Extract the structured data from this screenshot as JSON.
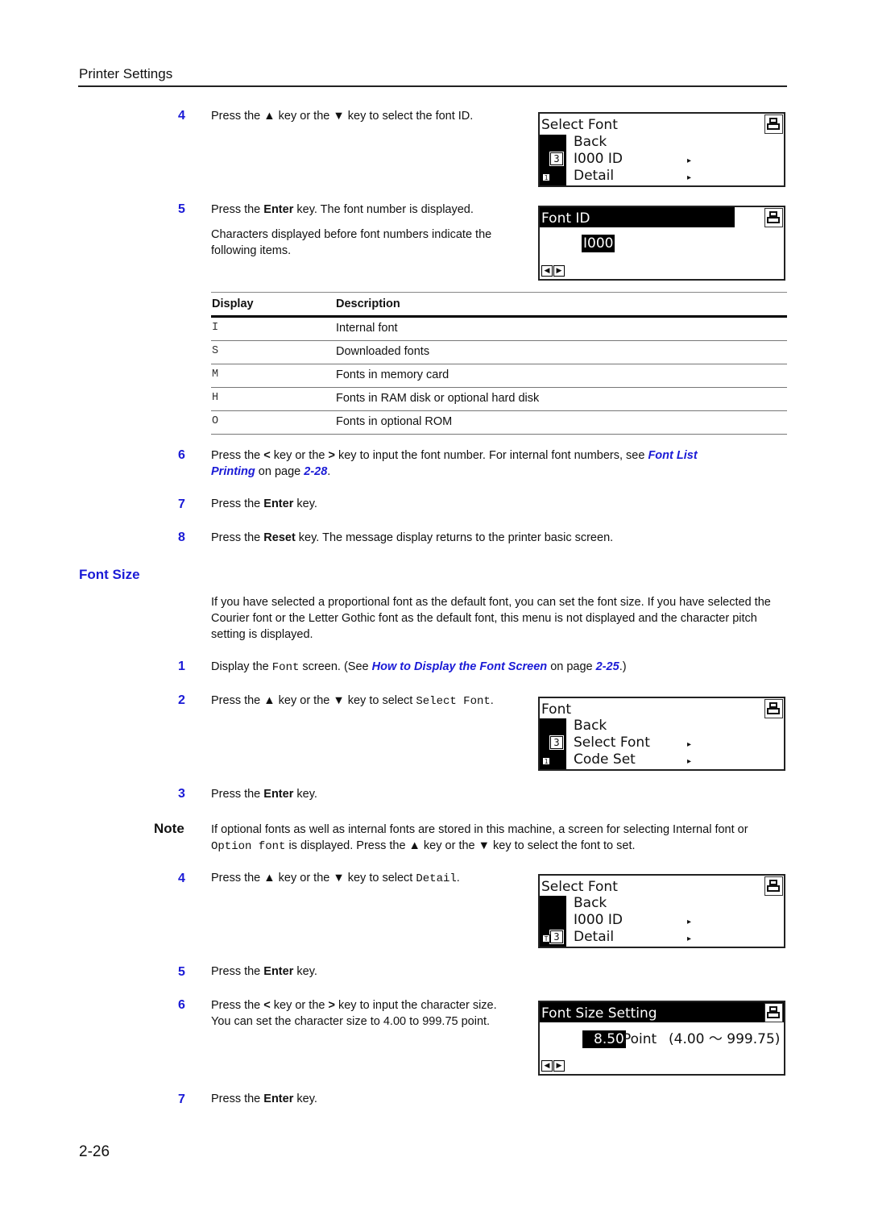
{
  "header": {
    "title": "Printer Settings"
  },
  "steps_top": [
    {
      "num": "4",
      "text_parts": [
        "Press the ",
        "▲",
        " key or the ",
        "▼",
        " key to select the font ID."
      ]
    },
    {
      "num": "5",
      "pre": "Press the ",
      "bold": "Enter",
      "post": " key. The font number is displayed.",
      "sub": "Characters displayed before font numbers indicate the following items."
    }
  ],
  "lcd_select_font_1": {
    "title": "Select Font",
    "items": [
      "Back",
      "I000  ID",
      "Detail"
    ],
    "page_box": "3",
    "small_box": "1",
    "arrow": "▸"
  },
  "lcd_font_id": {
    "title": "Font ID",
    "value": "I000",
    "left_key": "◀",
    "right_key": "▶"
  },
  "table": {
    "headers": [
      "Display",
      "Description"
    ],
    "rows": [
      [
        "I",
        "Internal font"
      ],
      [
        "S",
        "Downloaded fonts"
      ],
      [
        "M",
        "Fonts in memory card"
      ],
      [
        "H",
        "Fonts in RAM disk or optional hard disk"
      ],
      [
        "O",
        "Fonts in optional ROM"
      ]
    ]
  },
  "steps_mid": [
    {
      "num": "6",
      "pre": "Press the ",
      "k1": "<",
      "mid": " key or the ",
      "k2": ">",
      "post": " key to input the font number. For internal font numbers, see ",
      "link": "Font List Printing",
      "link_a": "Font List",
      "link_b": "Printing",
      "on_page": " on page ",
      "page": "2-28",
      "end": "."
    },
    {
      "num": "7",
      "pre": "Press the ",
      "bold": "Enter",
      "post": " key."
    },
    {
      "num": "8",
      "pre": "Press the ",
      "bold": "Reset",
      "post": " key. The message display returns to the printer basic screen."
    }
  ],
  "font_size": {
    "title": "Font Size",
    "intro": "If you have selected a proportional font as the default font, you can set the font size. If you have selected the Courier font or the Letter Gothic font as the default font, this menu is not displayed and the character pitch setting is displayed.",
    "step1": {
      "num": "1",
      "pre": "Display the ",
      "mono": "Font",
      "mid": " screen. (See ",
      "link": "How to Display the Font Screen",
      "on_page": " on page ",
      "page": "2-25",
      "end": ".)"
    },
    "step2": {
      "num": "2",
      "pre": "Press the ▲ key or the ▼ key to select ",
      "mono": "Select Font",
      "end": "."
    },
    "step3": {
      "num": "3",
      "pre": "Press the ",
      "bold": "Enter",
      "post": " key."
    },
    "note": {
      "label": "Note",
      "pre": "If optional fonts as well as internal fonts are stored in this machine, a screen for selecting Internal font or ",
      "mono": "Option font",
      "post": " is displayed. Press the ▲ key or the ▼ key to select the font to set."
    },
    "step4": {
      "num": "4",
      "pre": "Press the ▲ key or the ▼ key to select ",
      "mono": "Detail",
      "end": "."
    },
    "step5": {
      "num": "5",
      "pre": "Press the ",
      "bold": "Enter",
      "post": " key."
    },
    "step6": {
      "num": "6",
      "pre": "Press the ",
      "k1": "<",
      "mid": " key or the ",
      "k2": ">",
      "post": " key to input the character size.",
      "line2": "You can set the character size to 4.00 to 999.75 point."
    },
    "step7": {
      "num": "7",
      "pre": "Press the ",
      "bold": "Enter",
      "post": " key."
    }
  },
  "lcd_font": {
    "title": "Font",
    "items": [
      "Back",
      "Select Font",
      "Code Set"
    ],
    "page_box": "3",
    "small_box": "1",
    "arrow": "▸"
  },
  "lcd_select_font_2": {
    "title": "Select Font",
    "items": [
      "Back",
      "I000  ID",
      "Detail"
    ],
    "page_box": "3",
    "small_box": "T",
    "arrow": "▸"
  },
  "lcd_font_size_setting": {
    "title": "Font Size Setting",
    "value": "8.50",
    "unit": "Point",
    "range": "(4.00 ～ 999.75)",
    "left_key": "◀",
    "right_key": "▶"
  },
  "footer": {
    "page_number": "2-26"
  },
  "colors": {
    "accent_blue": "#1a1ad6",
    "text": "#111111"
  }
}
